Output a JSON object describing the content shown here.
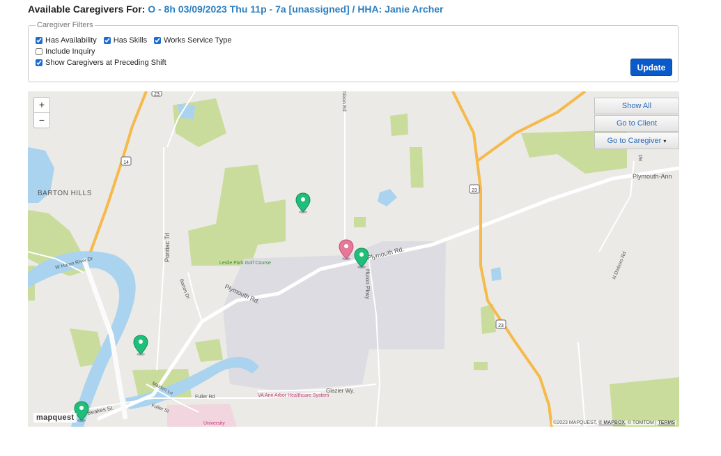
{
  "header": {
    "title_prefix": "Available Caregivers For:",
    "shift_link": "O - 8h 03/09/2023 Thu 11p - 7a [unassigned] / HHA: Janie Archer"
  },
  "filters": {
    "legend": "Caregiver Filters",
    "has_availability": {
      "label": "Has Availability",
      "checked": true
    },
    "has_skills": {
      "label": "Has Skills",
      "checked": true
    },
    "works_service_type": {
      "label": "Works Service Type",
      "checked": true
    },
    "include_inquiry": {
      "label": "Include Inquiry",
      "checked": false
    },
    "show_preceding": {
      "label": "Show Caregivers at Preceding Shift",
      "checked": true
    },
    "update_label": "Update"
  },
  "map": {
    "zoom_in": "+",
    "zoom_out": "−",
    "buttons": {
      "show_all": "Show All",
      "go_to_client": "Go to Client",
      "go_to_caregiver": "Go to Caregiver",
      "caret": "▾"
    },
    "labels": {
      "barton_hills": "BARTON HILLS",
      "plymouth_ann": "Plymouth-Ann",
      "plymouth_rd_east": "Plymouth Rd.",
      "plymouth_rd_west": "Plymouth Rd.",
      "pontiac_trl": "Pontiac Trl",
      "w_huron_river": "W Huron River Dr",
      "barton_dr": "Barton Dr",
      "huron_pkwy": "Huron Pkwy",
      "nixon_rd": "Nixon Rd",
      "n_dixboro": "N Dixboro Rd",
      "leslie_park": "Leslie Park Golf Course",
      "maiden_ln": "Maiden Ln",
      "fuller_rd": "Fuller Rd",
      "fuller_st": "Fuller St",
      "beakes_st": "Beakes St.",
      "glazier_wy": "Glazier Wy.",
      "va_hospital": "VA Ann Arbor Healthcare System",
      "university": "University",
      "rd_edge": "Rd",
      "route_23_a": "23",
      "route_23_b": "23",
      "route_23_c": "23",
      "route_14": "14"
    },
    "brand": "mapquest",
    "attribution": {
      "prefix": "©2023 MAPQUEST,",
      "mapbox": "© MAPBOX",
      "sep": ", © TOMTOM |",
      "terms": "TERMS"
    },
    "colors": {
      "client_pin": "#e8789a",
      "caregiver_pin": "#1fbf7a",
      "park": "#c9dc9c",
      "water": "#a9d3ee",
      "highway": "#f6b94b",
      "campus": "#d9d9df"
    }
  }
}
